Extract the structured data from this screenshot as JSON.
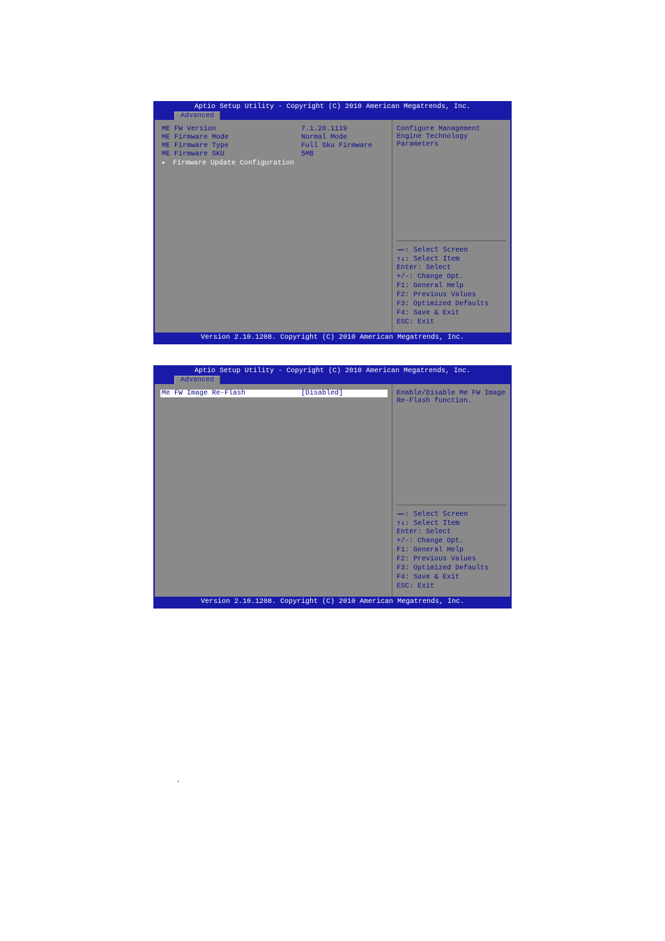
{
  "header_title": "Aptio Setup Utility - Copyright (C) 2010 American Megatrends, Inc.",
  "tab_label": "Advanced",
  "footer_version": "Version 2.10.1208. Copyright (C) 2010 American Megatrends, Inc.",
  "screen1": {
    "settings": [
      {
        "label": "ME FW Version",
        "value": "7.1.20.1119"
      },
      {
        "label": "ME Firmware Mode",
        "value": "Normal Mode"
      },
      {
        "label": "ME Firmware Type",
        "value": "Full Sku Firmware"
      },
      {
        "label": "ME Firmware SKU",
        "value": "5MB"
      }
    ],
    "submenu": "Firmware Update Configuration",
    "help_desc": "Configure Management Engine Technology Parameters"
  },
  "screen2": {
    "highlighted": {
      "label": "Me FW Image Re-Flash",
      "value": "[Disabled]"
    },
    "help_desc": "Enable/Disable Me FW Image Re-Flash function."
  },
  "keyhelp": {
    "l1": "→←: Select Screen",
    "l2": "↑↓: Select Item",
    "l3": "Enter: Select",
    "l4": "+/-: Change Opt.",
    "l5": "F1: General Help",
    "l6": "F2: Previous Values",
    "l7": "F3: Optimized Defaults",
    "l8": "F4: Save & Exit",
    "l9": "ESC: Exit"
  },
  "footnote": ","
}
